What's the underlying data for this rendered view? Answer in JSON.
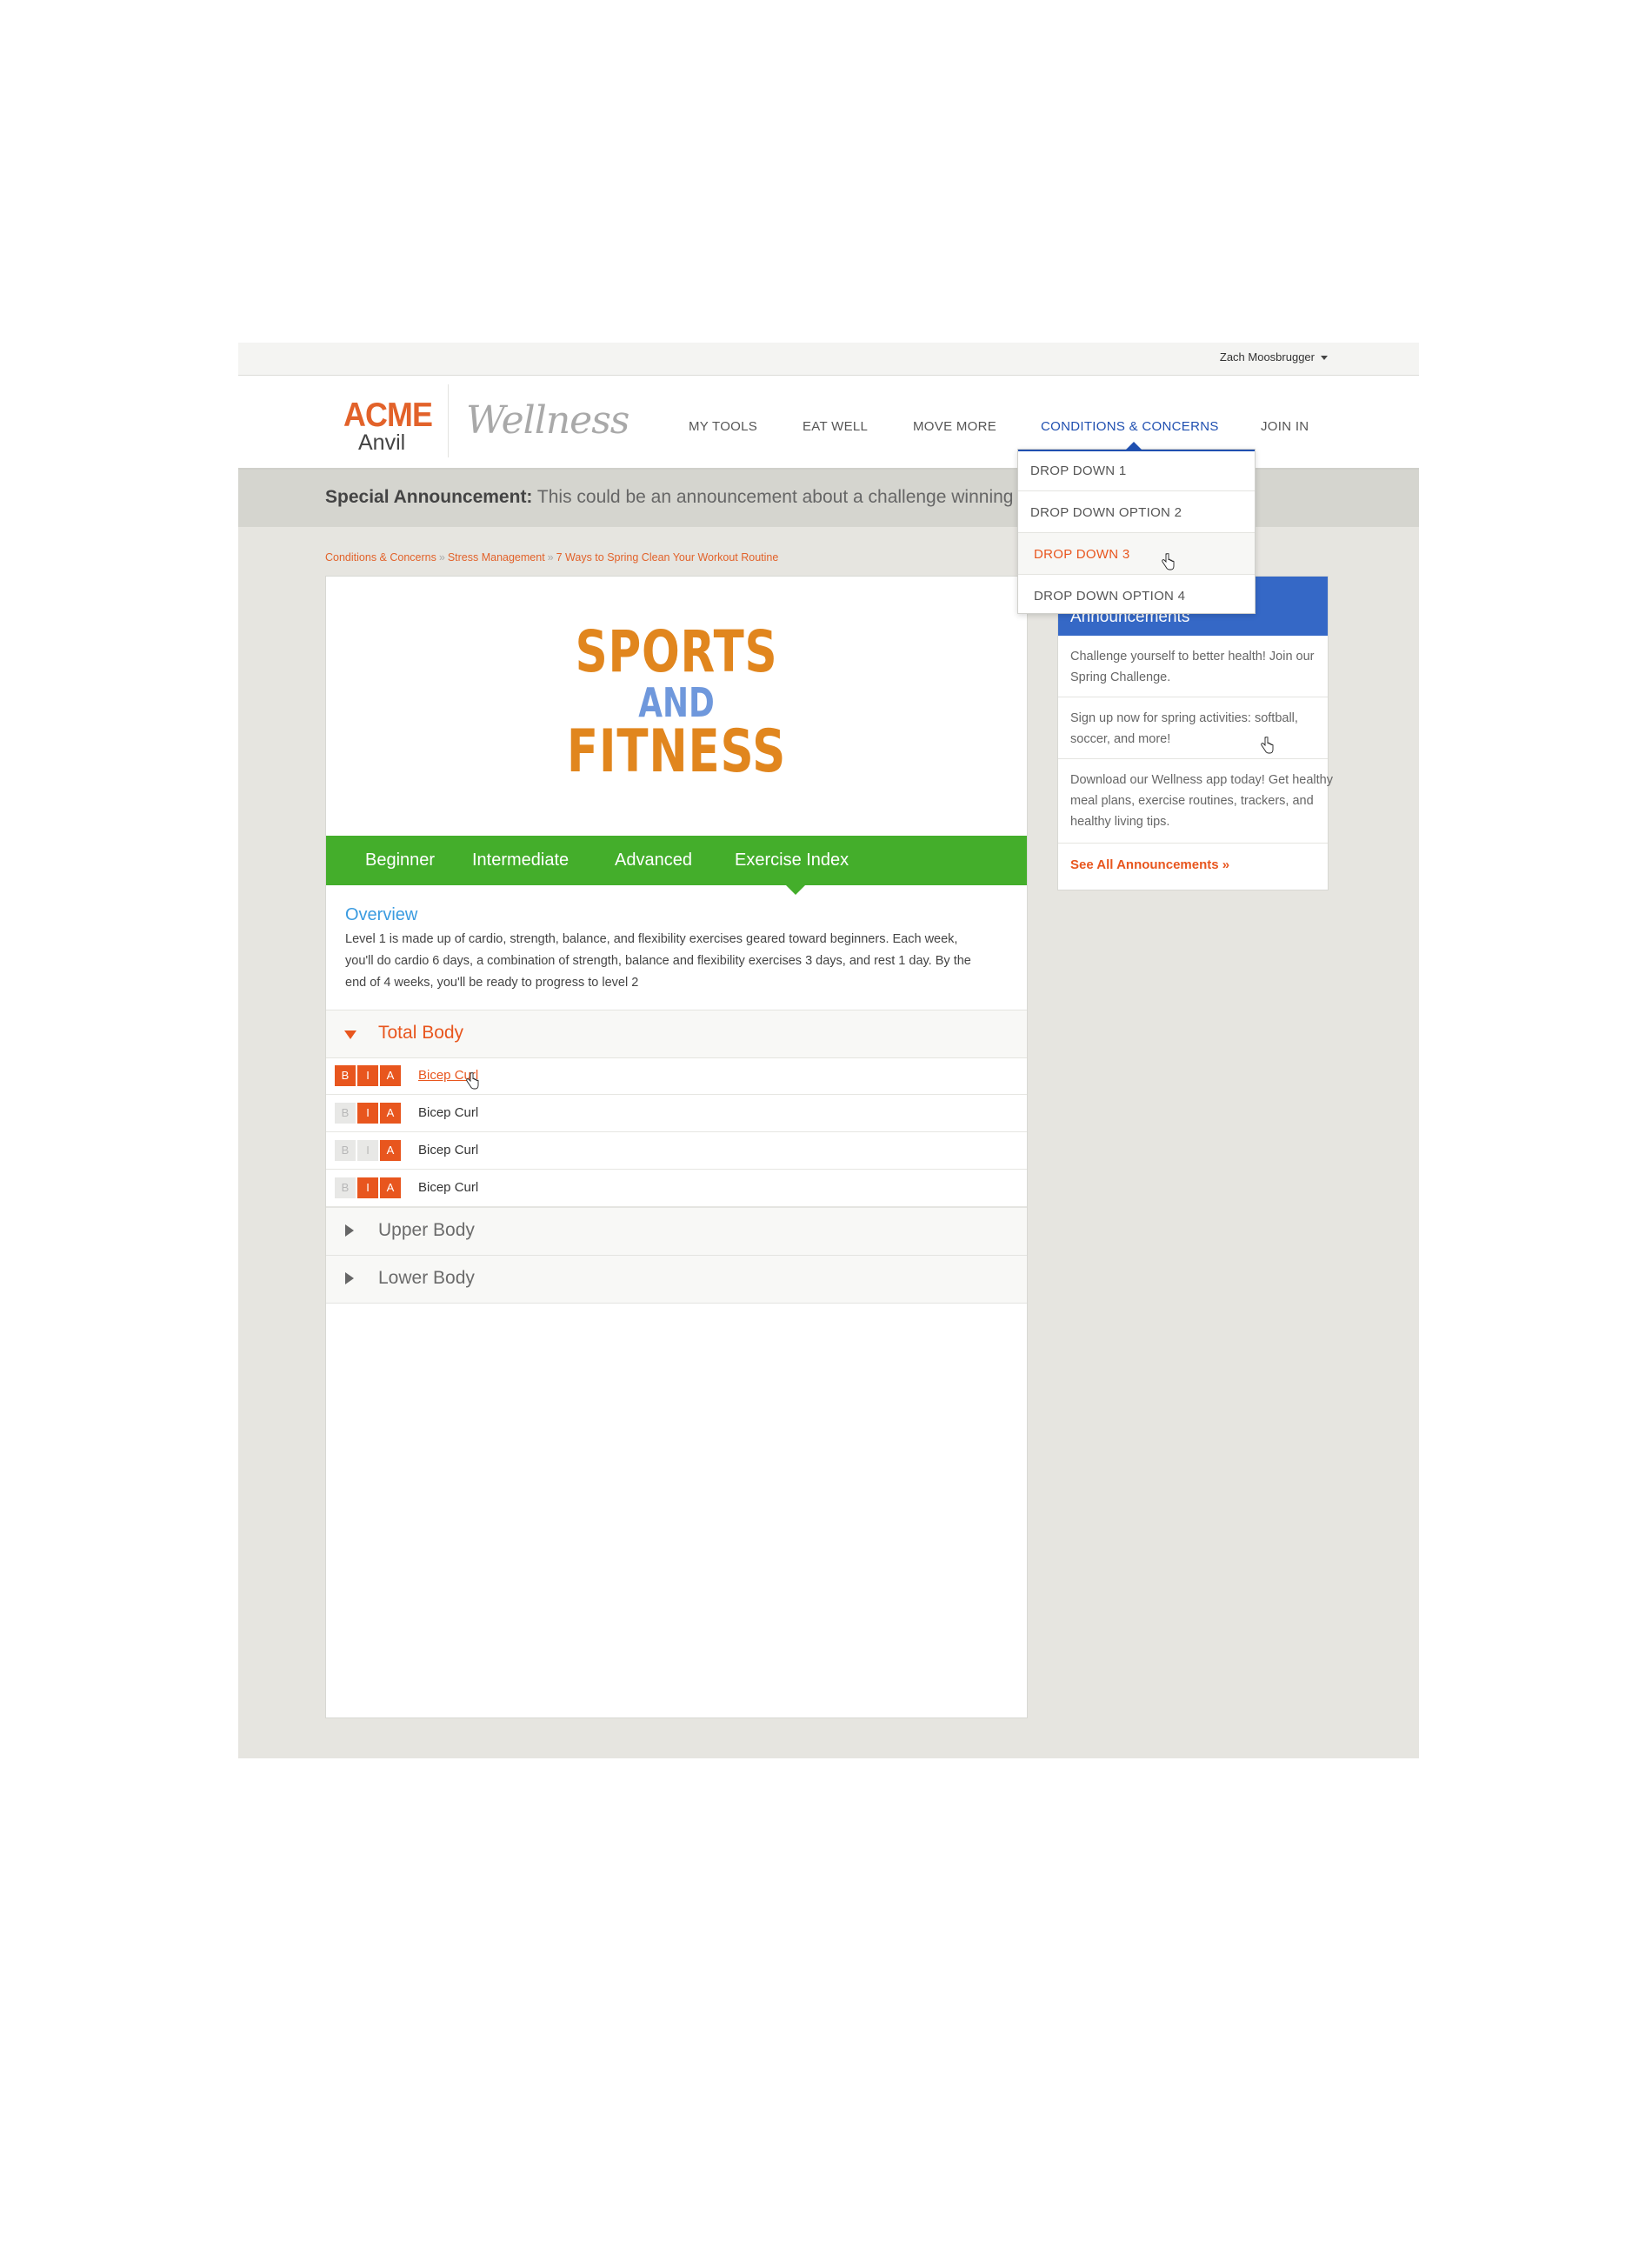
{
  "topbar": {
    "user_name": "Zach Moosbrugger"
  },
  "logo": {
    "brand_top": "ACME",
    "brand_bottom": "Anvil",
    "product": "Wellness"
  },
  "nav": {
    "items": [
      "MY TOOLS",
      "EAT WELL",
      "MOVE MORE",
      "CONDITIONS & CONCERNS",
      "JOIN IN"
    ],
    "active": "CONDITIONS & CONCERNS"
  },
  "dropdown": {
    "items": [
      "DROP DOWN 1",
      "DROP DOWN OPTION 2",
      "DROP DOWN 3",
      "DROP DOWN OPTION 4"
    ],
    "selected": "DROP DOWN 3"
  },
  "announcement": {
    "label": "Special Announcement:",
    "text": "This could be an announcement about a challenge winning team"
  },
  "breadcrumb": {
    "items": [
      "Conditions & Concerns",
      "Stress Management",
      "7 Ways to Spring Clean Your Workout Routine"
    ],
    "separator": "»"
  },
  "hero": {
    "line1": "SPORTS",
    "line2": "AND",
    "line3": "FITNESS"
  },
  "tabs": {
    "items": [
      "Beginner",
      "Intermediate",
      "Advanced",
      "Exercise Index"
    ],
    "active": "Exercise Index"
  },
  "overview": {
    "title": "Overview",
    "body": "Level 1 is made up of cardio, strength, balance, and flexibility exercises geared toward beginners. Each week, you'll do cardio 6 days, a combination of strength, balance and flexibility exercises 3 days, and rest 1 day. By the end of 4 weeks, you'll be ready to progress to level 2"
  },
  "sections": [
    {
      "title": "Total Body",
      "expanded": true,
      "exercises": [
        {
          "name": "Bicep Curl",
          "levels": [
            "B",
            "I",
            "A"
          ],
          "active": [
            true,
            true,
            true
          ],
          "highlighted": true
        },
        {
          "name": "Bicep Curl",
          "levels": [
            "B",
            "I",
            "A"
          ],
          "active": [
            false,
            true,
            true
          ],
          "highlighted": false
        },
        {
          "name": "Bicep Curl",
          "levels": [
            "B",
            "I",
            "A"
          ],
          "active": [
            false,
            false,
            true
          ],
          "highlighted": false
        },
        {
          "name": "Bicep Curl",
          "levels": [
            "B",
            "I",
            "A"
          ],
          "active": [
            false,
            true,
            true
          ],
          "highlighted": false
        }
      ]
    },
    {
      "title": "Upper Body",
      "expanded": false
    },
    {
      "title": "Lower Body",
      "expanded": false
    }
  ],
  "sidebar": {
    "title_fragment": "n",
    "title_line2": "Announcements",
    "items": [
      "Challenge yourself to better health! Join our Spring Challenge.",
      "Sign up now for spring activities: softball, soccer, and more!",
      "Download our Wellness app today! Get healthy meal plans, exercise routines, trackers, and healthy living tips."
    ],
    "link": "See All Announcements »"
  },
  "colors": {
    "accent_orange": "#e8561e",
    "nav_blue": "#1f4fb0",
    "tab_green": "#44ae2b",
    "sidebar_blue": "#3568c6",
    "hero_gold": "#e1861e",
    "hero_blue": "#6f98dc"
  },
  "icons": {
    "user_menu": "caret-down-icon",
    "section_open": "triangle-down-icon",
    "section_closed": "triangle-right-icon",
    "cursor": "hand-pointer-icon"
  }
}
